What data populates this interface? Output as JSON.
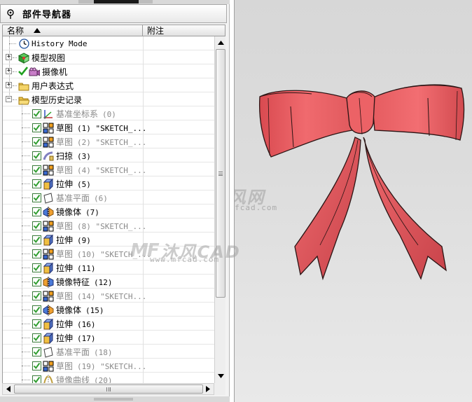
{
  "navigator": {
    "title": "部件导航器",
    "columns": {
      "name": "名称",
      "note": "附注"
    },
    "rows": [
      {
        "label": "History Mode",
        "icon": "clock-icon",
        "level": 1,
        "expander": "",
        "checked": false,
        "dim": false,
        "mono": true,
        "arg": ""
      },
      {
        "label": "模型视图",
        "icon": "model-views-icon",
        "level": 0,
        "expander": "+",
        "checked": false,
        "dim": false,
        "mono": false,
        "arg": ""
      },
      {
        "label": "摄像机",
        "icon": "camera-icon",
        "level": 0,
        "expander": "+",
        "checked": false,
        "dim": false,
        "mono": false,
        "arg": "",
        "tick": true
      },
      {
        "label": "用户表达式",
        "icon": "folder-icon",
        "level": 0,
        "expander": "+",
        "checked": false,
        "dim": false,
        "mono": false,
        "arg": ""
      },
      {
        "label": "模型历史记录",
        "icon": "folder-open-icon",
        "level": 0,
        "expander": "−",
        "checked": false,
        "dim": false,
        "mono": false,
        "arg": ""
      },
      {
        "label": "基准坐标系",
        "icon": "datum-csys-icon",
        "level": 2,
        "expander": "",
        "checked": true,
        "dim": true,
        "mono": false,
        "arg": "(0)"
      },
      {
        "label": "草图",
        "icon": "sketch-icon",
        "level": 2,
        "expander": "",
        "checked": true,
        "dim": false,
        "mono": false,
        "arg": "(1) \"SKETCH_..."
      },
      {
        "label": "草图",
        "icon": "sketch-icon",
        "level": 2,
        "expander": "",
        "checked": true,
        "dim": true,
        "mono": false,
        "arg": "(2) \"SKETCH_..."
      },
      {
        "label": "扫掠",
        "icon": "sweep-icon",
        "level": 2,
        "expander": "",
        "checked": true,
        "dim": false,
        "mono": false,
        "arg": "(3)"
      },
      {
        "label": "草图",
        "icon": "sketch-icon",
        "level": 2,
        "expander": "",
        "checked": true,
        "dim": true,
        "mono": false,
        "arg": "(4) \"SKETCH_..."
      },
      {
        "label": "拉伸",
        "icon": "extrude-icon",
        "level": 2,
        "expander": "",
        "checked": true,
        "dim": false,
        "mono": false,
        "arg": "(5)"
      },
      {
        "label": "基准平面",
        "icon": "datum-plane-icon",
        "level": 2,
        "expander": "",
        "checked": true,
        "dim": true,
        "mono": false,
        "arg": "(6)"
      },
      {
        "label": "镜像体",
        "icon": "mirror-body-icon",
        "level": 2,
        "expander": "",
        "checked": true,
        "dim": false,
        "mono": false,
        "arg": "(7)"
      },
      {
        "label": "草图",
        "icon": "sketch-icon",
        "level": 2,
        "expander": "",
        "checked": true,
        "dim": true,
        "mono": false,
        "arg": "(8) \"SKETCH_..."
      },
      {
        "label": "拉伸",
        "icon": "extrude-icon",
        "level": 2,
        "expander": "",
        "checked": true,
        "dim": false,
        "mono": false,
        "arg": "(9)"
      },
      {
        "label": "草图",
        "icon": "sketch-icon",
        "level": 2,
        "expander": "",
        "checked": true,
        "dim": true,
        "mono": false,
        "arg": "(10) \"SKETCH_..."
      },
      {
        "label": "拉伸",
        "icon": "extrude-icon",
        "level": 2,
        "expander": "",
        "checked": true,
        "dim": false,
        "mono": false,
        "arg": "(11)"
      },
      {
        "label": "镜像特征",
        "icon": "mirror-feature-icon",
        "level": 2,
        "expander": "",
        "checked": true,
        "dim": false,
        "mono": false,
        "arg": "(12)"
      },
      {
        "label": "草图",
        "icon": "sketch-icon",
        "level": 2,
        "expander": "",
        "checked": true,
        "dim": true,
        "mono": false,
        "arg": "(14) \"SKETCH..."
      },
      {
        "label": "镜像体",
        "icon": "mirror-body-icon",
        "level": 2,
        "expander": "",
        "checked": true,
        "dim": false,
        "mono": false,
        "arg": "(15)"
      },
      {
        "label": "拉伸",
        "icon": "extrude-icon",
        "level": 2,
        "expander": "",
        "checked": true,
        "dim": false,
        "mono": false,
        "arg": "(16)"
      },
      {
        "label": "拉伸",
        "icon": "extrude-icon",
        "level": 2,
        "expander": "",
        "checked": true,
        "dim": false,
        "mono": false,
        "arg": "(17)"
      },
      {
        "label": "基准平面",
        "icon": "datum-plane-icon",
        "level": 2,
        "expander": "",
        "checked": true,
        "dim": true,
        "mono": false,
        "arg": "(18)"
      },
      {
        "label": "草图",
        "icon": "sketch-icon",
        "level": 2,
        "expander": "",
        "checked": true,
        "dim": true,
        "mono": false,
        "arg": "(19) \"SKETCH..."
      },
      {
        "label": "镜像曲线",
        "icon": "mirror-curve-icon",
        "level": 2,
        "expander": "",
        "checked": true,
        "dim": true,
        "mono": false,
        "arg": "(20)"
      }
    ]
  },
  "viewport": {
    "watermark1": {
      "logo": "MF",
      "text": "沐风网",
      "url": "www.mfcad.com"
    },
    "watermark2": {
      "logo": "MF",
      "text": "沐风CAD",
      "url": "www.mfcad.com"
    },
    "model_color": "#e9585c",
    "model_shade": "#c7454a"
  },
  "colors": {
    "check_green": "#2f9d2f",
    "dim_text": "#8a8a8a"
  }
}
